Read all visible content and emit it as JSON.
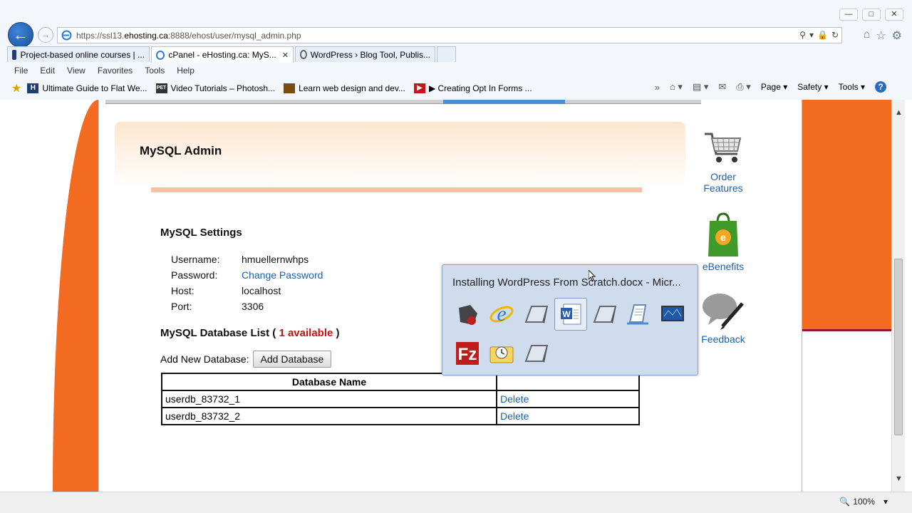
{
  "browser": {
    "url_prefix": "https://ssl13.",
    "url_domain": "ehosting.ca",
    "url_rest": ":8888/ehost/user/mysql_admin.php",
    "tabs": [
      {
        "label": "Project-based online courses | ...",
        "icon": "grid-icon"
      },
      {
        "label": "cPanel - eHosting.ca: MyS...",
        "icon": "ie-icon",
        "active": true
      },
      {
        "label": "WordPress › Blog Tool, Publis...",
        "icon": "wordpress-icon"
      }
    ],
    "menu": [
      "File",
      "Edit",
      "View",
      "Favorites",
      "Tools",
      "Help"
    ],
    "favorites": [
      "Ultimate Guide to Flat We...",
      "Video Tutorials – Photosh...",
      "Learn web design and dev...",
      "▶ Creating Opt In Forms ..."
    ],
    "command_bar": [
      "Page",
      "Safety",
      "Tools"
    ],
    "zoom": "100%"
  },
  "page": {
    "header_title": "MySQL Admin",
    "settings_title": "MySQL Settings",
    "settings": [
      {
        "label": "Username:",
        "value": "hmuellernwhps"
      },
      {
        "label": "Password:",
        "value": "Change Password",
        "link": true
      },
      {
        "label": "Host:",
        "value": "localhost"
      },
      {
        "label": "Port:",
        "value": "3306"
      }
    ],
    "db_list_title": "MySQL Database List (",
    "db_available": "1 available",
    "db_list_close": ")",
    "add_label": "Add New Database:",
    "add_button": "Add Database",
    "table_header": "Database Name",
    "databases": [
      {
        "name": "userdb_83732_1",
        "action": "Delete"
      },
      {
        "name": "userdb_83732_2",
        "action": "Delete"
      }
    ]
  },
  "sidebar": {
    "order_line1": "Order",
    "order_line2": "Features",
    "ebenefits": "eBenefits",
    "feedback": "Feedback"
  },
  "popup": {
    "title": "Installing WordPress From Scratch.docx - Micr..."
  },
  "colors": {
    "orange": "#f26b21",
    "link": "#1f5fa6",
    "available": "#d01010"
  }
}
